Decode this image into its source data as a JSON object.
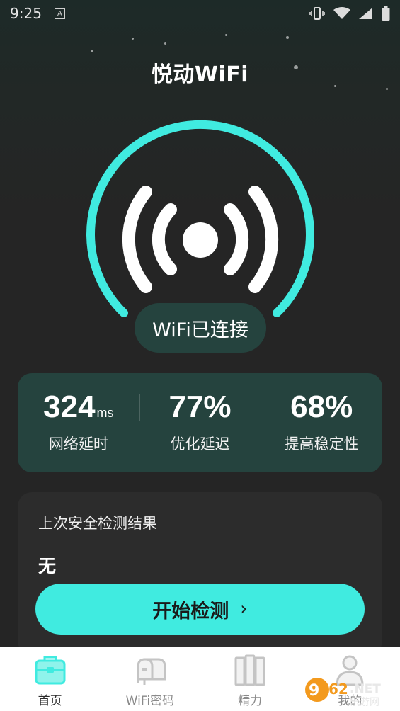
{
  "status_bar": {
    "time": "9:25",
    "notification_icon": "A"
  },
  "app": {
    "title": "悦动WiFi"
  },
  "connection": {
    "status": "WiFi已连接",
    "accent_color": "#40ebe0",
    "icon": "wifi-signal-icon"
  },
  "stats": [
    {
      "value": "324",
      "unit": "ms",
      "label": "网络延时"
    },
    {
      "value": "77%",
      "unit": "",
      "label": "优化延迟"
    },
    {
      "value": "68%",
      "unit": "",
      "label": "提高稳定性"
    }
  ],
  "security": {
    "title": "上次安全检测结果",
    "result": "无",
    "button_label": "开始检测",
    "button_chevron": "›"
  },
  "nav": [
    {
      "label": "首页",
      "icon": "toolbox-icon",
      "active": true
    },
    {
      "label": "WiFi密码",
      "icon": "mailbox-icon",
      "active": false
    },
    {
      "label": "精力",
      "icon": "books-icon",
      "active": false
    },
    {
      "label": "我的",
      "icon": "profile-icon",
      "active": false
    }
  ],
  "watermark": {
    "text": "962.NET",
    "subtext": "乐游网"
  }
}
